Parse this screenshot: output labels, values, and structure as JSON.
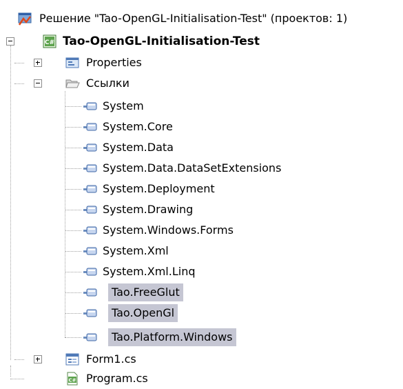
{
  "solution": {
    "label": "Решение \"Tao-OpenGL-Initialisation-Test\" (проектов: 1)",
    "icon": "solution-icon"
  },
  "project": {
    "label": "Tao-OpenGL-Initialisation-Test",
    "icon": "csharp-project-icon",
    "expanded": true
  },
  "properties": {
    "label": "Properties",
    "icon": "properties-icon",
    "expanded": false
  },
  "references": {
    "label": "Ссылки",
    "icon": "folder-open-icon",
    "expanded": true,
    "items": [
      {
        "label": "System",
        "selected": false
      },
      {
        "label": "System.Core",
        "selected": false
      },
      {
        "label": "System.Data",
        "selected": false
      },
      {
        "label": "System.Data.DataSetExtensions",
        "selected": false
      },
      {
        "label": "System.Deployment",
        "selected": false
      },
      {
        "label": "System.Drawing",
        "selected": false
      },
      {
        "label": "System.Windows.Forms",
        "selected": false
      },
      {
        "label": "System.Xml",
        "selected": false
      },
      {
        "label": "System.Xml.Linq",
        "selected": false
      },
      {
        "label": "Tao.FreeGlut",
        "selected": true
      },
      {
        "label": "Tao.OpenGl",
        "selected": true
      },
      {
        "label": "Tao.Platform.Windows",
        "selected": true
      }
    ],
    "item_icon": "reference-icon"
  },
  "form1": {
    "label": "Form1.cs",
    "icon": "form-icon",
    "expanded": false
  },
  "program": {
    "label": "Program.cs",
    "icon": "csharp-file-icon"
  },
  "colors": {
    "selection": "#c5c6d3",
    "tree_lines": "#a0a0a0"
  }
}
